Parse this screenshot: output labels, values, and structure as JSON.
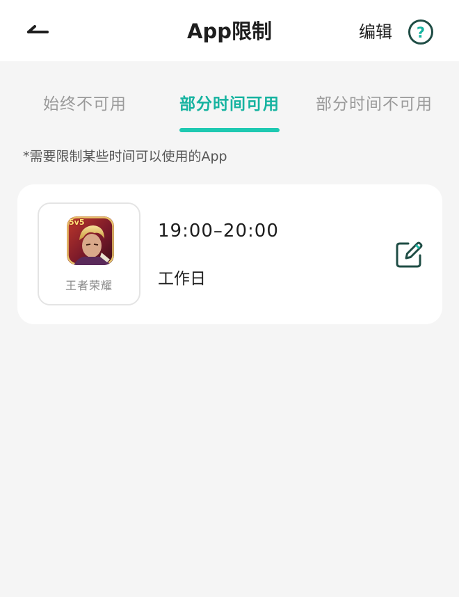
{
  "header": {
    "title": "App限制",
    "edit_label": "编辑",
    "back_icon": "back-arrow-icon",
    "help_icon": "help-icon"
  },
  "tabs": [
    {
      "label": "始终不可用",
      "active": false
    },
    {
      "label": "部分时间可用",
      "active": true
    },
    {
      "label": "部分时间不可用",
      "active": false
    }
  ],
  "note": "*需要限制某些时间可以使用的App",
  "rules": [
    {
      "app_name": "王者荣耀",
      "app_icon_badge": "5v5",
      "time_range": "19:00–20:00",
      "days": "工作日",
      "edit_icon": "edit-icon"
    }
  ],
  "colors": {
    "accent": "#1ec9b1",
    "accent_text": "#16b3a0",
    "icon_dark": "#1f4d45",
    "background": "#f5f5f5",
    "card": "#ffffff",
    "inactive_tab": "#9a9a9a"
  }
}
